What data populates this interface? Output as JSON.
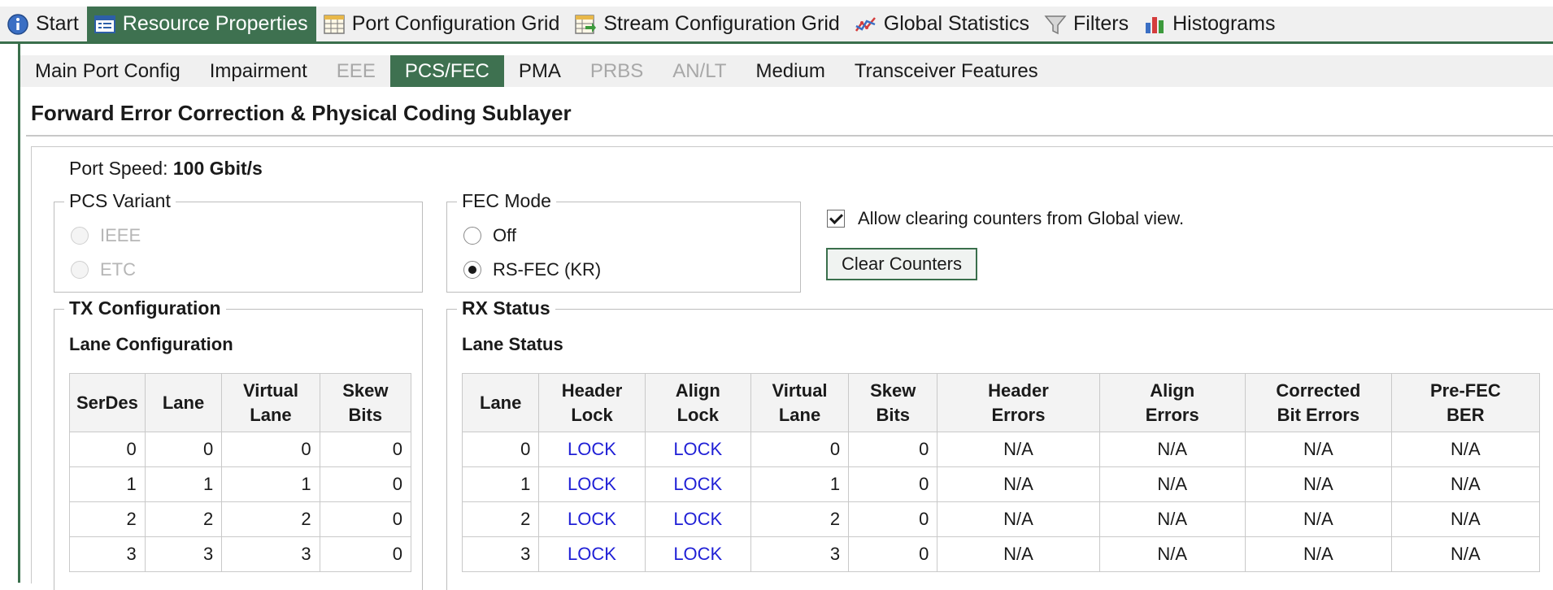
{
  "top_tabs": [
    {
      "label": "Start",
      "icon": "info-icon"
    },
    {
      "label": "Resource Properties",
      "icon": "properties-icon",
      "active": true
    },
    {
      "label": "Port Configuration Grid",
      "icon": "grid-icon"
    },
    {
      "label": "Stream Configuration Grid",
      "icon": "stream-grid-icon"
    },
    {
      "label": "Global Statistics",
      "icon": "line-chart-icon"
    },
    {
      "label": "Filters",
      "icon": "funnel-icon"
    },
    {
      "label": "Histograms",
      "icon": "bar-chart-icon"
    }
  ],
  "sub_tabs": [
    {
      "label": "Main Port Config"
    },
    {
      "label": "Impairment"
    },
    {
      "label": "EEE",
      "disabled": true
    },
    {
      "label": "PCS/FEC",
      "active": true
    },
    {
      "label": "PMA"
    },
    {
      "label": "PRBS",
      "disabled": true
    },
    {
      "label": "AN/LT",
      "disabled": true
    },
    {
      "label": "Medium"
    },
    {
      "label": "Transceiver Features"
    }
  ],
  "section_title": "Forward Error Correction & Physical Coding Sublayer",
  "port_speed": {
    "label": "Port Speed:",
    "value": "100 Gbit/s"
  },
  "pcs_variant": {
    "title": "PCS Variant",
    "options": [
      "IEEE",
      "ETC"
    ]
  },
  "fec_mode": {
    "title": "FEC Mode",
    "options": [
      "Off",
      "RS-FEC (KR)"
    ],
    "selected": "RS-FEC (KR)"
  },
  "allow_clear": {
    "label": "Allow clearing counters from Global view.",
    "checked": true
  },
  "clear_button": "Clear Counters",
  "tx": {
    "title": "TX Configuration",
    "subtitle": "Lane Configuration",
    "headers": [
      "SerDes",
      "Lane",
      "Virtual\nLane",
      "Skew\nBits"
    ],
    "rows": [
      [
        "0",
        "0",
        "0",
        "0"
      ],
      [
        "1",
        "1",
        "1",
        "0"
      ],
      [
        "2",
        "2",
        "2",
        "0"
      ],
      [
        "3",
        "3",
        "3",
        "0"
      ]
    ]
  },
  "rx": {
    "title": "RX Status",
    "subtitle": "Lane Status",
    "headers": [
      "Lane",
      "Header\nLock",
      "Align\nLock",
      "Virtual\nLane",
      "Skew\nBits",
      "Header\nErrors",
      "Align\nErrors",
      "Corrected\nBit Errors",
      "Pre-FEC\nBER"
    ],
    "rows": [
      [
        "0",
        "LOCK",
        "LOCK",
        "0",
        "0",
        "N/A",
        "N/A",
        "N/A",
        "N/A"
      ],
      [
        "1",
        "LOCK",
        "LOCK",
        "1",
        "0",
        "N/A",
        "N/A",
        "N/A",
        "N/A"
      ],
      [
        "2",
        "LOCK",
        "LOCK",
        "2",
        "0",
        "N/A",
        "N/A",
        "N/A",
        "N/A"
      ],
      [
        "3",
        "LOCK",
        "LOCK",
        "3",
        "0",
        "N/A",
        "N/A",
        "N/A",
        "N/A"
      ]
    ]
  },
  "colors": {
    "accent": "#3e7150",
    "lock_text": "#1f1fd6",
    "disabled_text": "#a8a8a8"
  }
}
